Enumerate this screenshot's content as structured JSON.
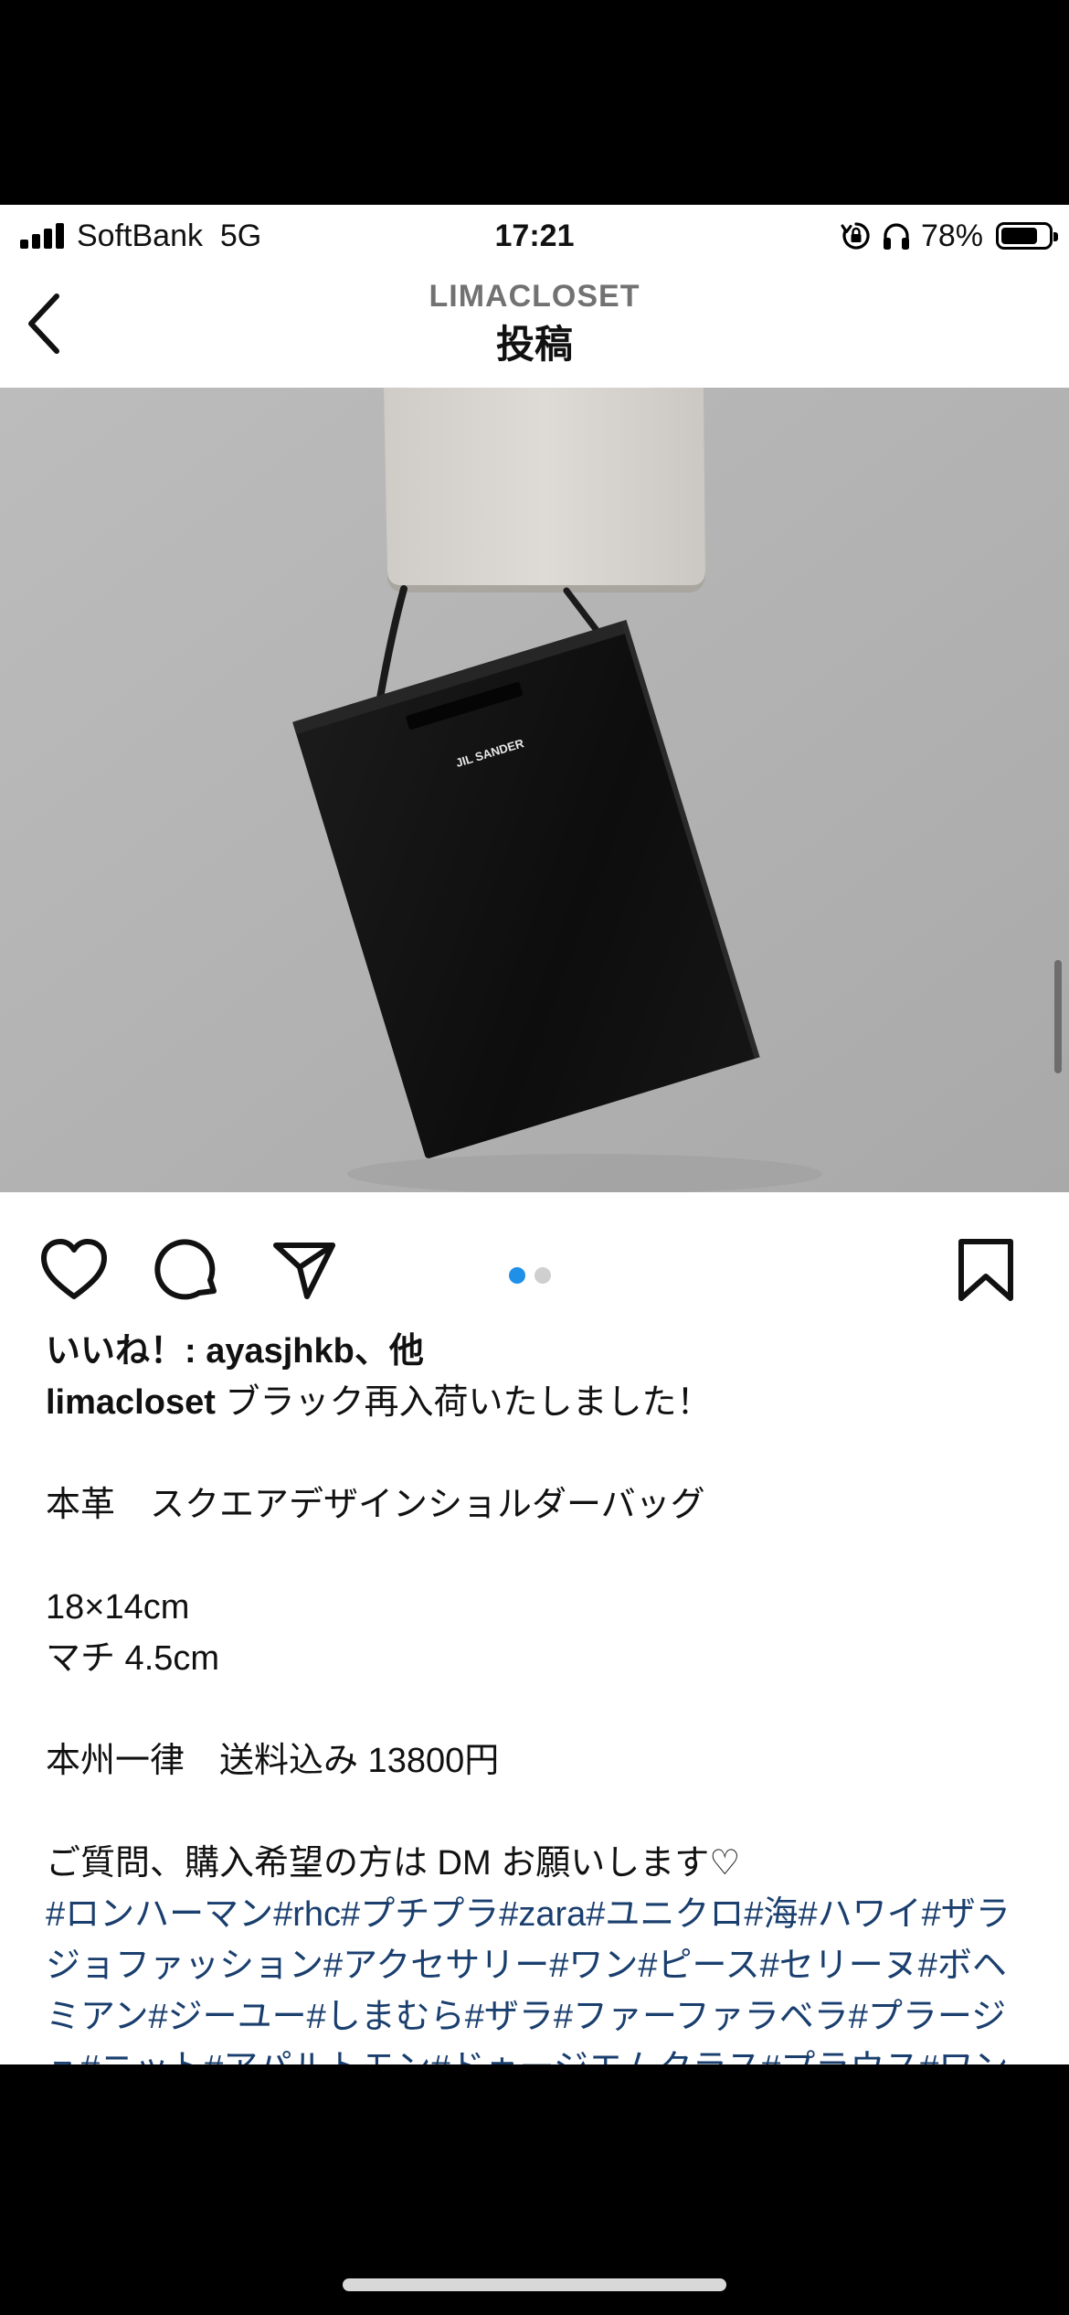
{
  "status_bar": {
    "carrier": "SoftBank",
    "network": "5G",
    "time": "17:21",
    "battery_percent_text": "78%",
    "battery_level": 0.78
  },
  "header": {
    "account": "LIMACLOSET",
    "title": "投稿"
  },
  "carousel": {
    "page_count": 2,
    "active_page": 1
  },
  "post": {
    "likes_text": "いいね！: ayasjhkb、他",
    "username": "limacloset",
    "caption_first_line": "ブラック再入荷いたしました！",
    "caption_lines": [
      "本革　スクエアデザインショルダーバッグ",
      "18×14cm",
      "マチ 4.5cm",
      "本州一律　送料込み 13800円",
      "ご質問、購入希望の方は DM お願いします♡"
    ],
    "hashtags": "#ロンハーマン#rhc#プチプラ#zara#ユニクロ#海#ハワイ#ザラジョファッション#アクセサリー#ワン#ピース#セリーヌ#ボヘミアン#ジーユー#しまむら#ザラ#ファーファラベラ#プラージュ#ニット#アパルトモン#ドゥージエムクラス#プラウス#ワンピース#ファー#ファーバッグ"
  },
  "colors": {
    "hashtag": "#1a3f6e",
    "carousel_active_dot": "#1e90e8",
    "carousel_inactive_dot": "#cfcfcf"
  },
  "icons": {
    "back": "chevron-left-icon",
    "like": "heart-icon",
    "comment": "comment-icon",
    "share": "paper-plane-icon",
    "save": "bookmark-icon"
  }
}
